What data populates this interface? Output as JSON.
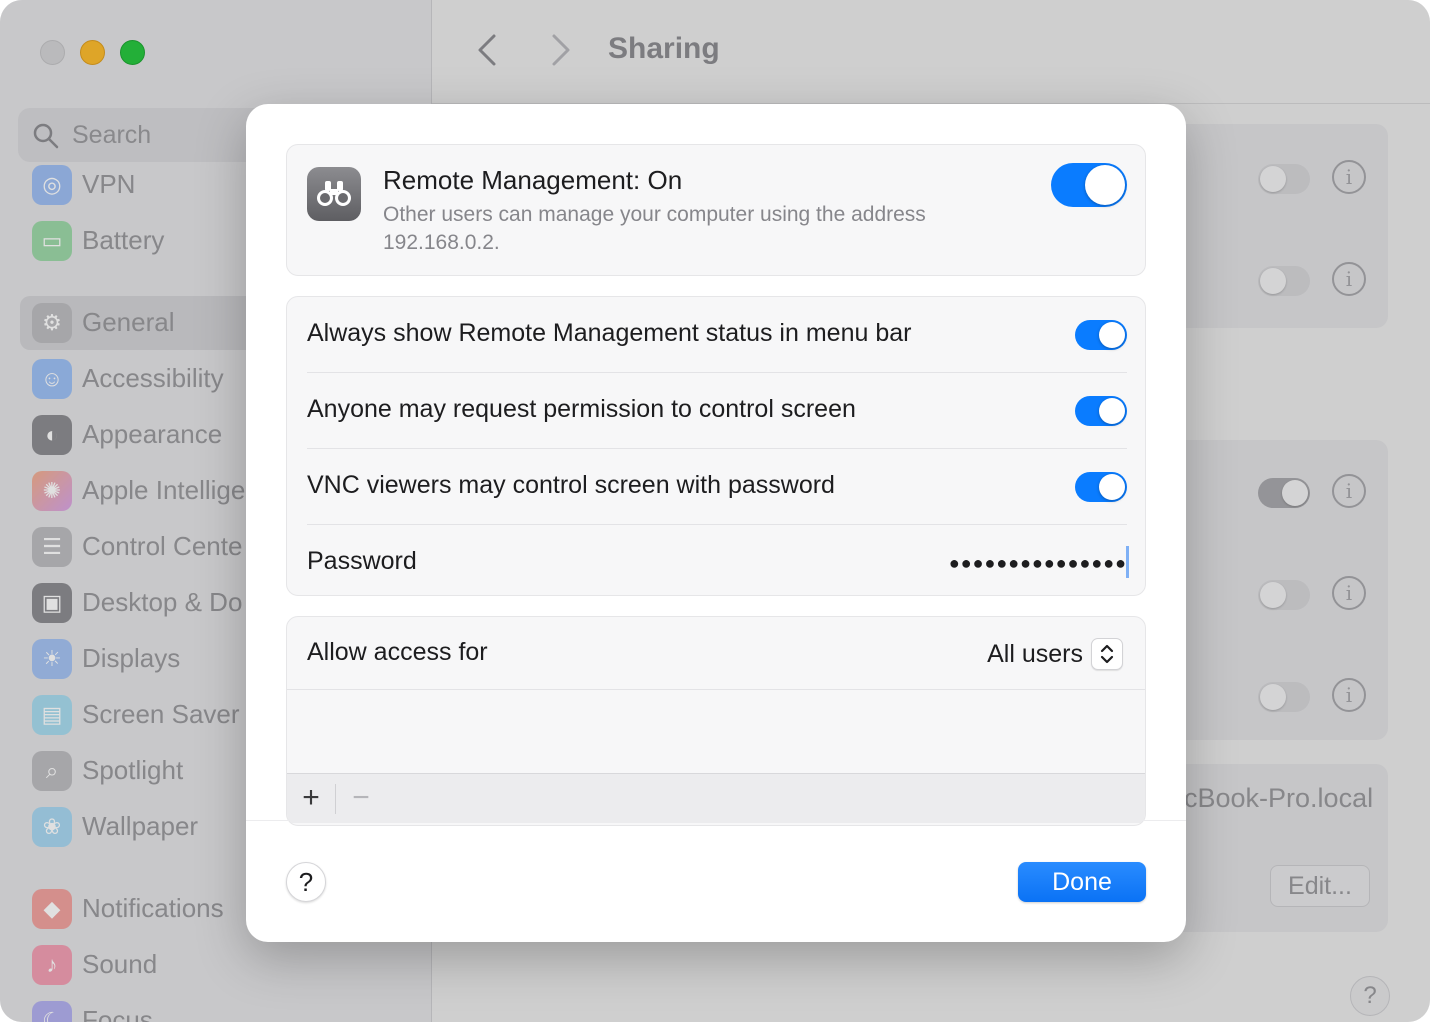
{
  "window": {
    "title": "Sharing",
    "search_placeholder": "Search"
  },
  "sidebar": {
    "items": [
      {
        "label": "VPN",
        "icon": "vpn-icon",
        "color": "#3b7ff5"
      },
      {
        "label": "Battery",
        "icon": "battery-icon",
        "color": "#34c759"
      },
      {
        "label": "General",
        "icon": "gear-icon",
        "color": "#8e8e93",
        "selected": true
      },
      {
        "label": "Accessibility",
        "icon": "accessibility-icon",
        "color": "#1a84ff"
      },
      {
        "label": "Appearance",
        "icon": "appearance-icon",
        "color": "#1d1d1f"
      },
      {
        "label": "Apple Intellige",
        "icon": "apple-intelligence-icon",
        "color": "#f08a5d"
      },
      {
        "label": "Control Cente",
        "icon": "control-center-icon",
        "color": "#8e8e93"
      },
      {
        "label": "Desktop & Do",
        "icon": "desktop-dock-icon",
        "color": "#1d1d1f"
      },
      {
        "label": "Displays",
        "icon": "displays-icon",
        "color": "#3b82f6"
      },
      {
        "label": "Screen Saver",
        "icon": "screen-saver-icon",
        "color": "#5ac8fa"
      },
      {
        "label": "Spotlight",
        "icon": "spotlight-icon",
        "color": "#8e8e93"
      },
      {
        "label": "Wallpaper",
        "icon": "wallpaper-icon",
        "color": "#4fc3f7"
      },
      {
        "label": "Notifications",
        "icon": "notifications-icon",
        "color": "#ff3b30"
      },
      {
        "label": "Sound",
        "icon": "sound-icon",
        "color": "#ff2d55"
      },
      {
        "label": "Focus",
        "icon": "focus-icon",
        "color": "#5e5ce6"
      }
    ]
  },
  "background": {
    "host_text": "cBook-Pro.local",
    "edit_label": "Edit...",
    "help_label": "?"
  },
  "sheet": {
    "remote_management": {
      "title": "Remote Management: On",
      "description": "Other users can manage your computer using the address 192.168.0.2.",
      "enabled": true
    },
    "options": [
      {
        "label": "Always show Remote Management status in menu bar",
        "enabled": true
      },
      {
        "label": "Anyone may request permission to control screen",
        "enabled": true
      },
      {
        "label": "VNC viewers may control screen with password",
        "enabled": true
      }
    ],
    "password": {
      "label": "Password",
      "value": "●●●●●●●●●●●●●●●"
    },
    "access": {
      "label": "Allow access for",
      "selected": "All users"
    },
    "list_controls": {
      "add": "+",
      "remove": "−"
    },
    "help_label": "?",
    "done_label": "Done",
    "accent_color": "#0a7cff"
  }
}
